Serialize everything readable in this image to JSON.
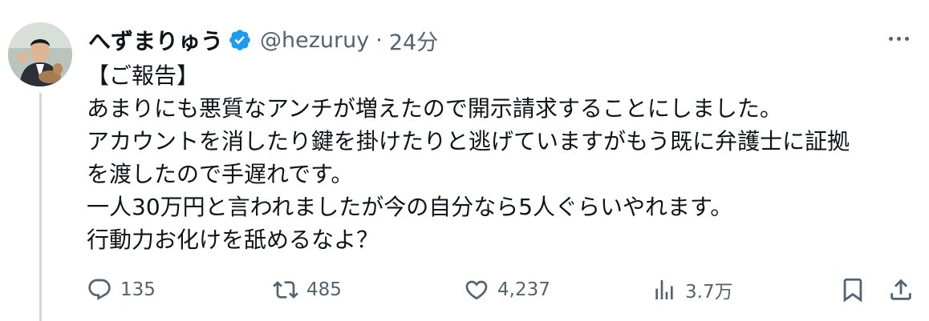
{
  "tweet": {
    "display_name": "へずまりゅう",
    "handle": "@hezuruy",
    "separator": "·",
    "time": "24分",
    "lines": [
      "【ご報告】",
      "あまりにも悪質なアンチが増えたので開示請求することにしました。",
      "アカウントを消したり鍵を掛けたりと逃げていますがもう既に弁護士に証拠",
      "を渡したので手遅れです。",
      "一人30万円と言われましたが今の自分なら5人ぐらいやれます。",
      "行動力お化けを舐めるなよ？"
    ],
    "stats": {
      "replies": "135",
      "retweets": "485",
      "likes": "4,237",
      "views": "3.7万"
    }
  },
  "icons": {
    "verified": "verified-badge-icon",
    "more": "more-options-icon",
    "reply": "reply-icon",
    "retweet": "retweet-icon",
    "like": "heart-icon",
    "views": "views-chart-icon",
    "bookmark": "bookmark-icon",
    "share": "share-icon"
  },
  "colors": {
    "verified": "#1d9bf0",
    "text": "#0f1419",
    "secondary": "#536471",
    "thread_line": "#cfd9de"
  }
}
